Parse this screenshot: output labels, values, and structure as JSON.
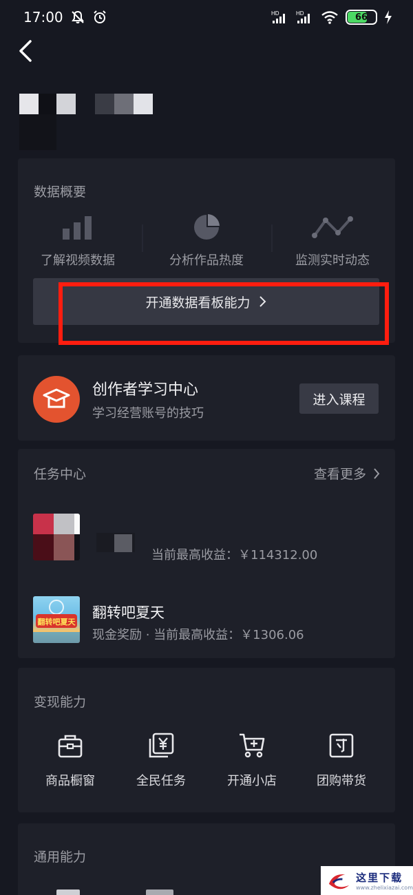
{
  "status_bar": {
    "time": "17:00",
    "battery": 66,
    "net_labels": [
      "HD",
      "HD"
    ]
  },
  "overview": {
    "title": "数据概要",
    "items": [
      {
        "label": "了解视频数据",
        "icon": "bar-chart-icon"
      },
      {
        "label": "分析作品热度",
        "icon": "pie-chart-icon"
      },
      {
        "label": "监测实时动态",
        "icon": "line-chart-icon"
      }
    ],
    "open_button": "开通数据看板能力"
  },
  "learning": {
    "title": "创作者学习中心",
    "subtitle": "学习经营账号的技巧",
    "button": "进入课程"
  },
  "tasks": {
    "title": "任务中心",
    "more": "查看更多",
    "items": [
      {
        "name": "",
        "desc": "当前最高收益：￥114312.00"
      },
      {
        "name": "翻转吧夏天",
        "desc": "现金奖励 · 当前最高收益：￥1306.06",
        "thumb_text": "翻转吧夏天"
      }
    ]
  },
  "monetize": {
    "title": "变现能力",
    "items": [
      {
        "label": "商品橱窗",
        "icon": "storefront-bag-icon"
      },
      {
        "label": "全民任务",
        "icon": "yuan-task-icon"
      },
      {
        "label": "开通小店",
        "icon": "cart-add-icon"
      },
      {
        "label": "团购带货",
        "icon": "group-buy-icon"
      }
    ]
  },
  "general": {
    "title": "通用能力"
  },
  "watermark": {
    "text": "这里下载",
    "url": "www.zhelixiazai.com"
  },
  "colors": {
    "background": "#161821",
    "card": "#1e2029",
    "button": "#363843",
    "accent_red": "#ff1d0f",
    "learn_logo": "#e3532f",
    "muted_text": "#9b9ca3"
  }
}
